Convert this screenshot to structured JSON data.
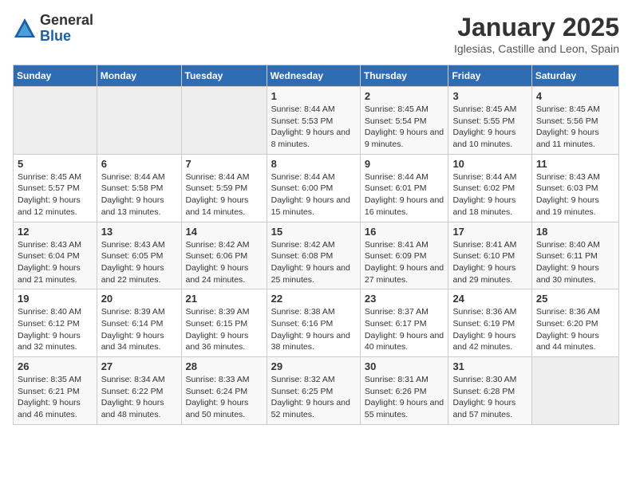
{
  "logo": {
    "general": "General",
    "blue": "Blue"
  },
  "title": "January 2025",
  "subtitle": "Iglesias, Castille and Leon, Spain",
  "weekdays": [
    "Sunday",
    "Monday",
    "Tuesday",
    "Wednesday",
    "Thursday",
    "Friday",
    "Saturday"
  ],
  "weeks": [
    [
      {
        "day": "",
        "info": ""
      },
      {
        "day": "",
        "info": ""
      },
      {
        "day": "",
        "info": ""
      },
      {
        "day": "1",
        "info": "Sunrise: 8:44 AM\nSunset: 5:53 PM\nDaylight: 9 hours and 8 minutes."
      },
      {
        "day": "2",
        "info": "Sunrise: 8:45 AM\nSunset: 5:54 PM\nDaylight: 9 hours and 9 minutes."
      },
      {
        "day": "3",
        "info": "Sunrise: 8:45 AM\nSunset: 5:55 PM\nDaylight: 9 hours and 10 minutes."
      },
      {
        "day": "4",
        "info": "Sunrise: 8:45 AM\nSunset: 5:56 PM\nDaylight: 9 hours and 11 minutes."
      }
    ],
    [
      {
        "day": "5",
        "info": "Sunrise: 8:45 AM\nSunset: 5:57 PM\nDaylight: 9 hours and 12 minutes."
      },
      {
        "day": "6",
        "info": "Sunrise: 8:44 AM\nSunset: 5:58 PM\nDaylight: 9 hours and 13 minutes."
      },
      {
        "day": "7",
        "info": "Sunrise: 8:44 AM\nSunset: 5:59 PM\nDaylight: 9 hours and 14 minutes."
      },
      {
        "day": "8",
        "info": "Sunrise: 8:44 AM\nSunset: 6:00 PM\nDaylight: 9 hours and 15 minutes."
      },
      {
        "day": "9",
        "info": "Sunrise: 8:44 AM\nSunset: 6:01 PM\nDaylight: 9 hours and 16 minutes."
      },
      {
        "day": "10",
        "info": "Sunrise: 8:44 AM\nSunset: 6:02 PM\nDaylight: 9 hours and 18 minutes."
      },
      {
        "day": "11",
        "info": "Sunrise: 8:43 AM\nSunset: 6:03 PM\nDaylight: 9 hours and 19 minutes."
      }
    ],
    [
      {
        "day": "12",
        "info": "Sunrise: 8:43 AM\nSunset: 6:04 PM\nDaylight: 9 hours and 21 minutes."
      },
      {
        "day": "13",
        "info": "Sunrise: 8:43 AM\nSunset: 6:05 PM\nDaylight: 9 hours and 22 minutes."
      },
      {
        "day": "14",
        "info": "Sunrise: 8:42 AM\nSunset: 6:06 PM\nDaylight: 9 hours and 24 minutes."
      },
      {
        "day": "15",
        "info": "Sunrise: 8:42 AM\nSunset: 6:08 PM\nDaylight: 9 hours and 25 minutes."
      },
      {
        "day": "16",
        "info": "Sunrise: 8:41 AM\nSunset: 6:09 PM\nDaylight: 9 hours and 27 minutes."
      },
      {
        "day": "17",
        "info": "Sunrise: 8:41 AM\nSunset: 6:10 PM\nDaylight: 9 hours and 29 minutes."
      },
      {
        "day": "18",
        "info": "Sunrise: 8:40 AM\nSunset: 6:11 PM\nDaylight: 9 hours and 30 minutes."
      }
    ],
    [
      {
        "day": "19",
        "info": "Sunrise: 8:40 AM\nSunset: 6:12 PM\nDaylight: 9 hours and 32 minutes."
      },
      {
        "day": "20",
        "info": "Sunrise: 8:39 AM\nSunset: 6:14 PM\nDaylight: 9 hours and 34 minutes."
      },
      {
        "day": "21",
        "info": "Sunrise: 8:39 AM\nSunset: 6:15 PM\nDaylight: 9 hours and 36 minutes."
      },
      {
        "day": "22",
        "info": "Sunrise: 8:38 AM\nSunset: 6:16 PM\nDaylight: 9 hours and 38 minutes."
      },
      {
        "day": "23",
        "info": "Sunrise: 8:37 AM\nSunset: 6:17 PM\nDaylight: 9 hours and 40 minutes."
      },
      {
        "day": "24",
        "info": "Sunrise: 8:36 AM\nSunset: 6:19 PM\nDaylight: 9 hours and 42 minutes."
      },
      {
        "day": "25",
        "info": "Sunrise: 8:36 AM\nSunset: 6:20 PM\nDaylight: 9 hours and 44 minutes."
      }
    ],
    [
      {
        "day": "26",
        "info": "Sunrise: 8:35 AM\nSunset: 6:21 PM\nDaylight: 9 hours and 46 minutes."
      },
      {
        "day": "27",
        "info": "Sunrise: 8:34 AM\nSunset: 6:22 PM\nDaylight: 9 hours and 48 minutes."
      },
      {
        "day": "28",
        "info": "Sunrise: 8:33 AM\nSunset: 6:24 PM\nDaylight: 9 hours and 50 minutes."
      },
      {
        "day": "29",
        "info": "Sunrise: 8:32 AM\nSunset: 6:25 PM\nDaylight: 9 hours and 52 minutes."
      },
      {
        "day": "30",
        "info": "Sunrise: 8:31 AM\nSunset: 6:26 PM\nDaylight: 9 hours and 55 minutes."
      },
      {
        "day": "31",
        "info": "Sunrise: 8:30 AM\nSunset: 6:28 PM\nDaylight: 9 hours and 57 minutes."
      },
      {
        "day": "",
        "info": ""
      }
    ]
  ]
}
